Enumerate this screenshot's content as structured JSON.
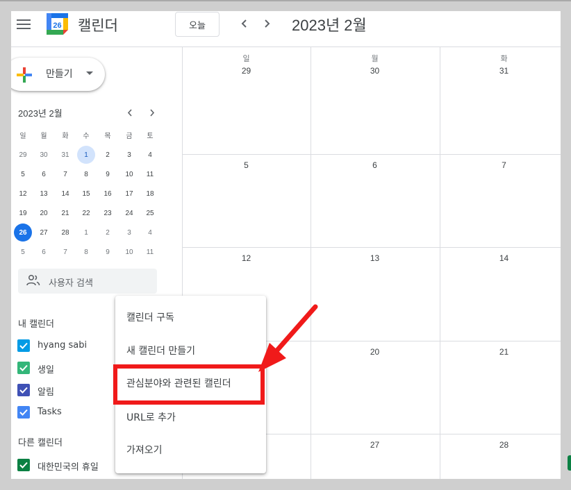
{
  "header": {
    "app_title": "캘린더",
    "logo_date": "26",
    "today_label": "오늘",
    "month_title": "2023년 2월"
  },
  "sidebar": {
    "create_label": "만들기",
    "mini_calendar": {
      "title": "2023년 2월",
      "weekdays": [
        "일",
        "월",
        "화",
        "수",
        "목",
        "금",
        "토"
      ],
      "weeks": [
        [
          "29",
          "30",
          "31",
          "1",
          "2",
          "3",
          "4"
        ],
        [
          "5",
          "6",
          "7",
          "8",
          "9",
          "10",
          "11"
        ],
        [
          "12",
          "13",
          "14",
          "15",
          "16",
          "17",
          "18"
        ],
        [
          "19",
          "20",
          "21",
          "22",
          "23",
          "24",
          "25"
        ],
        [
          "26",
          "27",
          "28",
          "1",
          "2",
          "3",
          "4"
        ],
        [
          "5",
          "6",
          "7",
          "8",
          "9",
          "10",
          "11"
        ]
      ]
    },
    "people_search_label": "사용자 검색",
    "my_calendars_title": "내 캘린더",
    "my_calendars": [
      {
        "label": "hyang sabi",
        "color": "#039be5"
      },
      {
        "label": "생일",
        "color": "#33b679"
      },
      {
        "label": "알림",
        "color": "#3f51b5"
      },
      {
        "label": "Tasks",
        "color": "#4285f4"
      }
    ],
    "other_calendars_title": "다른 캘린더",
    "other_calendars": [
      {
        "label": "대한민국의 휴일",
        "color": "#0b8043"
      }
    ]
  },
  "main": {
    "weekdays": [
      "일",
      "월",
      "화"
    ],
    "rows": [
      [
        "29",
        "30",
        "31"
      ],
      [
        "5",
        "6",
        "7"
      ],
      [
        "12",
        "13",
        "14"
      ],
      [
        "",
        "20",
        "21"
      ],
      [
        "",
        "27",
        "28"
      ]
    ]
  },
  "menu": {
    "items": [
      "캘린더 구독",
      "새 캘린더 만들기",
      "관심분야와 관련된 캘린더",
      "URL로 추가",
      "가져오기"
    ]
  },
  "colors": {
    "accent": "#1a73e8",
    "highlight": "#f01a1a"
  }
}
